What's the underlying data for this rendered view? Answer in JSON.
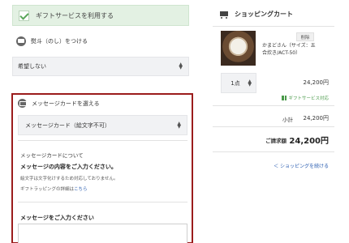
{
  "gift_service": {
    "label": "ギフトサービスを利用する",
    "checked": true
  },
  "noshi": {
    "heading": "熨斗（のし）をつける",
    "selected": "希望しない"
  },
  "message_card": {
    "heading": "メッセージカードを選える",
    "selected": "メッセージカード（絵文字不可）",
    "about": "メッセージカードについて",
    "prompt": "メッセージの内容をご入力ください。",
    "note_emoji": "絵文字は文字化けするため対応しておりません。",
    "note_wrapping_prefix": "ギフトラッピングの詳細は",
    "note_wrapping_link": "こちら",
    "input_label": "メッセージをご入力ください"
  },
  "cart": {
    "title": "ショッピングカート",
    "item": {
      "name": "かまどさん（サイズ：五合炊き/ACT-50）",
      "delete_label": "削除",
      "quantity": "1点",
      "price": "24,200円",
      "gift_status": "ギフトサービス対応"
    },
    "subtotal_label": "小計",
    "subtotal": "24,200円",
    "total_label": "ご請求額",
    "total": "24,200円",
    "continue_label": "＜ ショッピングを続ける"
  },
  "colors": {
    "highlight_border": "#9b1c1c",
    "gift_banner_bg": "#e3f1e3",
    "link": "#2a5db0",
    "gift_ok": "#4a9a4a"
  },
  "icons": {
    "gift_check": "check-icon",
    "noshi": "noshi-icon",
    "message": "message-card-icon",
    "cart": "cart-icon",
    "gift_ok": "gift-icon"
  }
}
